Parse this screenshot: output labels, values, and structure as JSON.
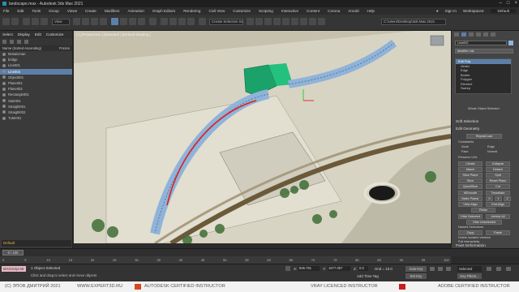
{
  "window": {
    "title": "landscape.max - Autodesk 3ds Max 2021"
  },
  "menu": [
    "File",
    "Edit",
    "Tools",
    "Group",
    "Views",
    "Create",
    "Modifiers",
    "Animation",
    "Graph Editors",
    "Rendering",
    "Civil View",
    "Customize",
    "Scripting",
    "Interactive",
    "Content",
    "Corona",
    "Arnold",
    "Help"
  ],
  "menu_right": {
    "signin": "Sign In",
    "workspaces": "Workspaces:",
    "workspace": "Default"
  },
  "toolbar": {
    "selection_set": "Create Selection Se",
    "path": "C:\\Users\\Desktop\\3ds Max 2021",
    "view_mode": "View"
  },
  "scene_explorer": {
    "tabs": [
      "Select",
      "Display",
      "Edit",
      "Customize"
    ],
    "sort": "Name (Sorted Ascending)",
    "frozen": "Frozen",
    "items": [
      "Mosaicman",
      "bridge",
      "Line001",
      "Line002",
      "Object001",
      "Plane001",
      "Plane002",
      "Rectangle001",
      "Stair001",
      "Straight001",
      "Straight002",
      "Tube001"
    ],
    "selected_index": 3,
    "layer": "Default"
  },
  "viewport": {
    "label": "[+] [Perspective ] [Standard ] [Default Shading ]"
  },
  "command_panel": {
    "object_name": "Line002",
    "modifier_list": "Modifier List",
    "modifiers": [
      "Edit Poly",
      "Vertex",
      "Edge",
      "Border",
      "Polygon",
      "Element",
      "Sweep"
    ],
    "modifier_selected": 0,
    "status_whole": "Whole Object Selected",
    "soft_selection": "Soft Selection",
    "edit_geometry": "Edit Geometry",
    "repeat_last": "Repeat Last",
    "constraints": "Constraints",
    "c_none": "None",
    "c_edge": "Edge",
    "c_face": "Face",
    "c_normal": "Normal",
    "preserve_uvs": "Preserve UVs",
    "create": "Create",
    "collapse": "Collapse",
    "attach": "Attach",
    "detach": "Detach",
    "slice_plane": "Slice Plane",
    "split": "Split",
    "slice": "Slice",
    "reset_plane": "Reset Plane",
    "quickslice": "QuickSlice",
    "cut": "Cut",
    "msmooth": "MSmooth",
    "tessellate": "Tessellate",
    "make_planar": "Make Planar",
    "x": "X",
    "y": "Y",
    "z": "Z",
    "view_align": "View Align",
    "grid_align": "Grid Align",
    "relax": "Relax",
    "hide_selected": "Hide Selected",
    "unhide_all": "Unhide All",
    "hide_unselected": "Hide Unselected",
    "named_selections": "Named Selections:",
    "copy": "Copy",
    "paste": "Paste",
    "delete_isolated": "Delete Isolated Vertices",
    "full_interactivity": "Full Interactivity",
    "paint_deformation": "Paint Deformation"
  },
  "timeline": {
    "frame": "0 / 100",
    "ticks": [
      "0",
      "5",
      "10",
      "15",
      "20",
      "25",
      "30",
      "35",
      "40",
      "45",
      "50",
      "55",
      "60",
      "65",
      "70",
      "75",
      "80",
      "85",
      "90",
      "95",
      "100"
    ]
  },
  "status": {
    "maxscript": "MAXScript Mi",
    "objects_selected": "1 Object Selected",
    "prompt": "Click and drag to select and move objects",
    "x_label": "X:",
    "x_val": "606.781",
    "y_label": "Y:",
    "y_val": "1677.057",
    "z_label": "Z:",
    "z_val": "0.0",
    "grid": "Grid = 10.0",
    "add_time_tag": "Add Time Tag",
    "autokey": "Auto Key",
    "set_key": "Set Key",
    "selected": "Selected",
    "key_filters": "Key Filters..."
  },
  "footer": {
    "copyright": "(C) ЭПОВ ДМИТРИЙ 2021",
    "site": "WWW.EXPERT3D.RU",
    "autodesk": "AUTODESK CERTIFIED INSTRUCTOR",
    "vray": "VRAY LICENCED INSTRUCTOR",
    "adobe": "ADOBE CERTIFIED INSTRUCTOR"
  },
  "colors": {
    "accent": "#5c7fa8",
    "selected_spline": "#e02020",
    "stairs": "#1aa26a",
    "bridge": "#8fb3d9"
  }
}
